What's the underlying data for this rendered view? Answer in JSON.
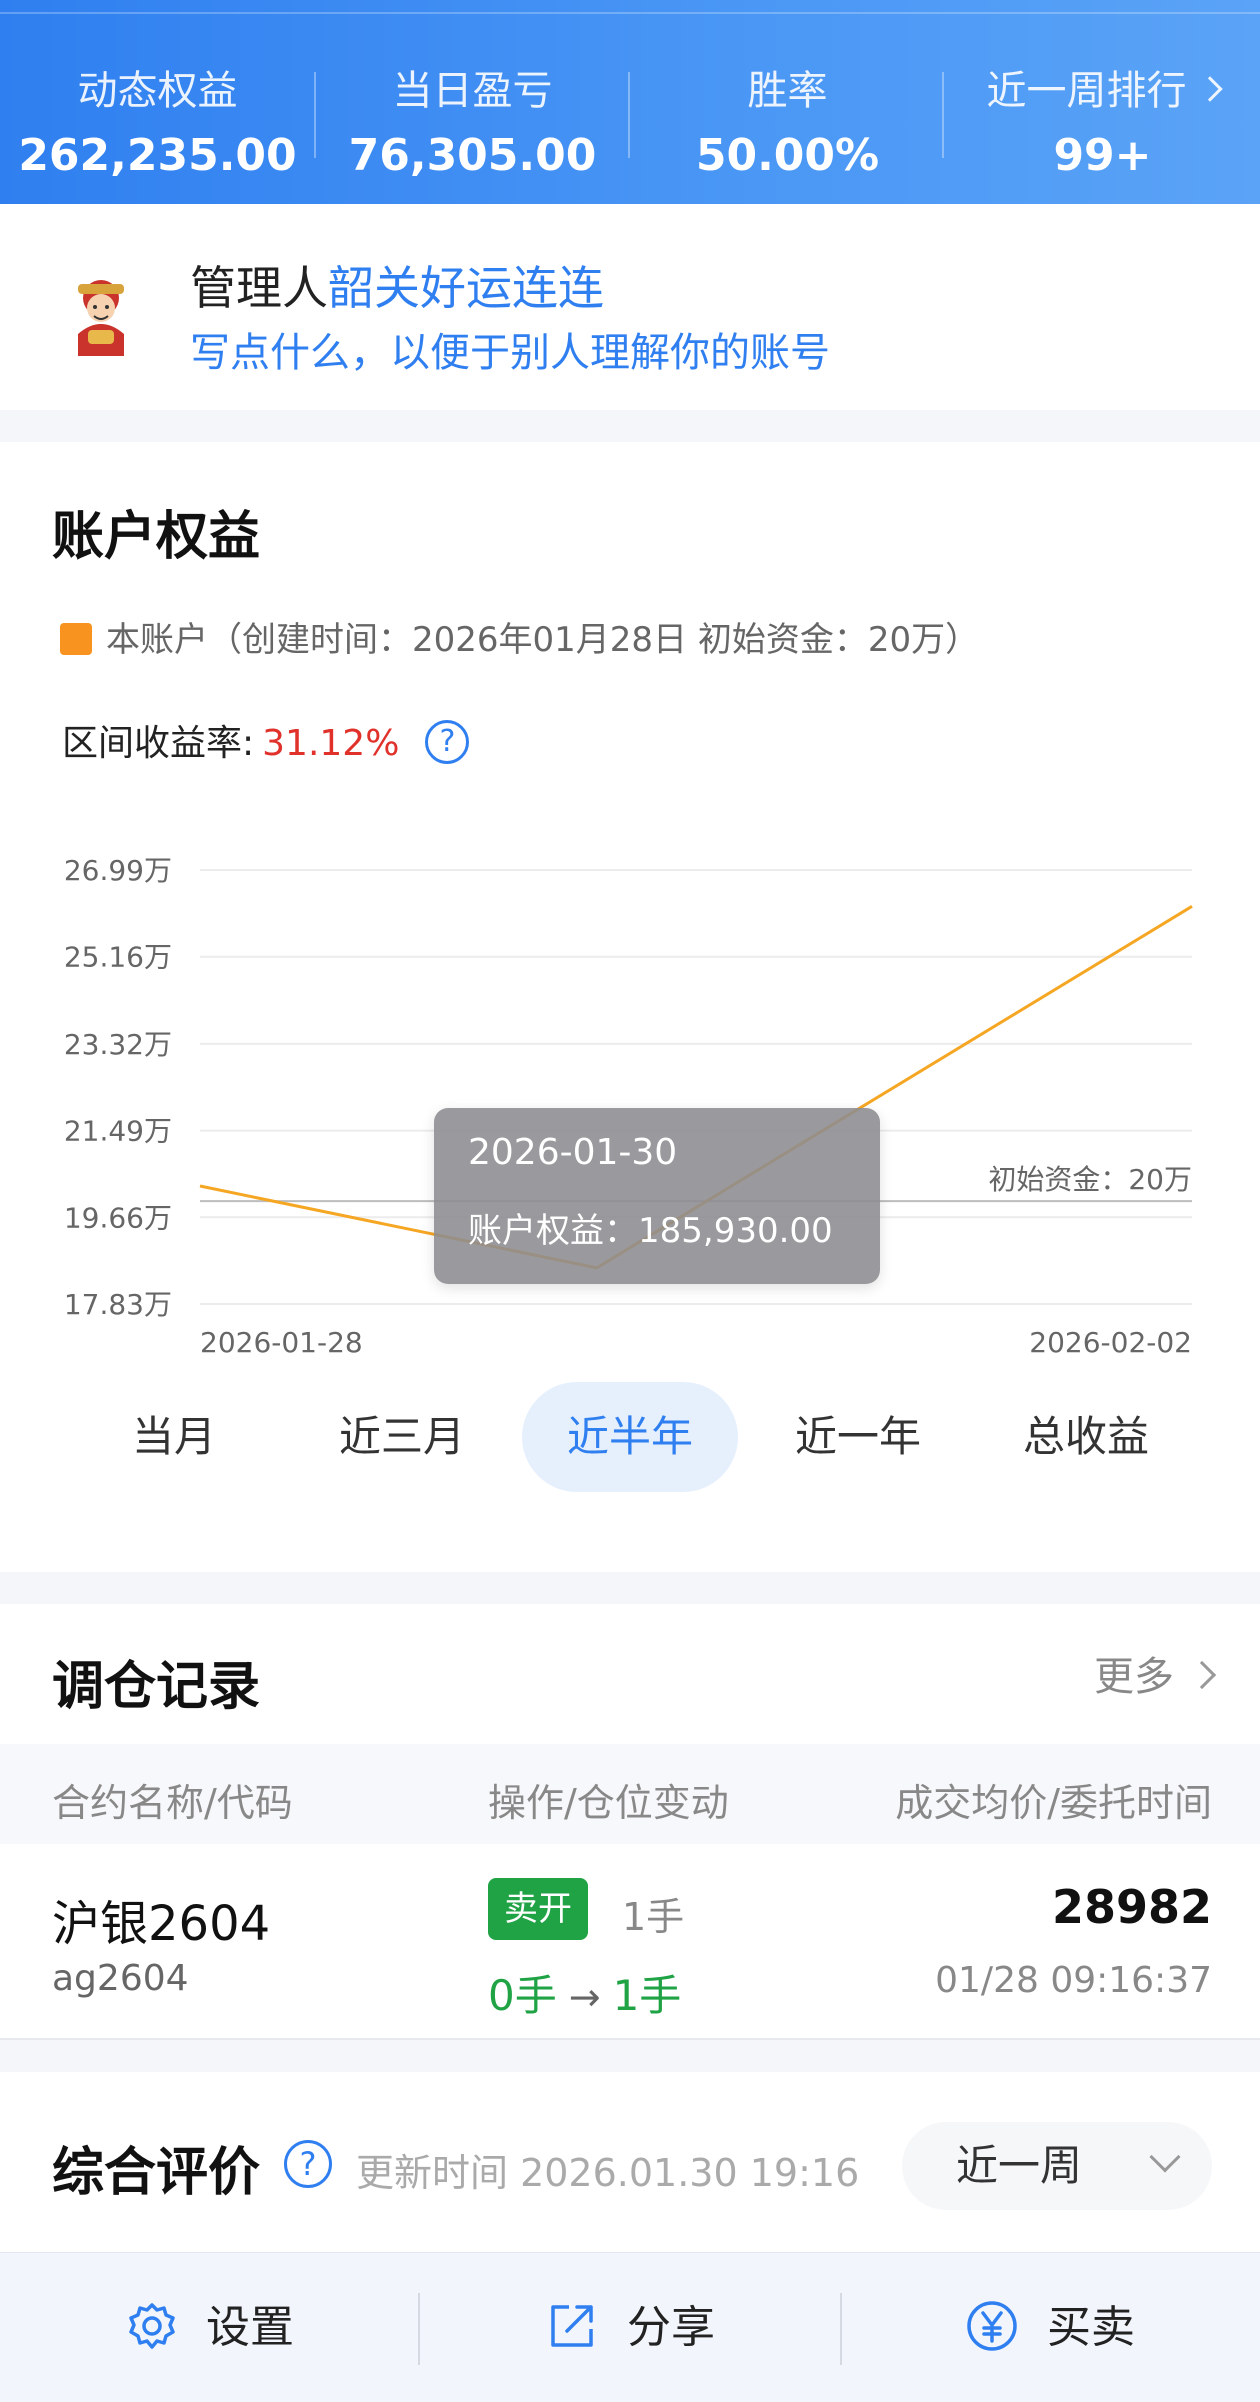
{
  "header": {
    "stats": [
      {
        "label": "动态权益",
        "value": "262,235.00"
      },
      {
        "label": "当日盈亏",
        "value": "76,305.00"
      },
      {
        "label": "胜率",
        "value": "50.00%"
      },
      {
        "label": "近一周排行",
        "value": "99+"
      }
    ]
  },
  "manager": {
    "prefix": "管理人",
    "name": "韶关好运连连",
    "description": "写点什么，以便于别人理解你的账号"
  },
  "equity": {
    "title": "账户权益",
    "legend": "本账户（创建时间：2026年01月28日 初始资金：20万）",
    "yield_label": "区间收益率:",
    "yield_value": "31.12%",
    "help_glyph": "?",
    "tooltip": {
      "date": "2026-01-30",
      "label": "账户权益：",
      "value": "185,930.00"
    },
    "baseline_label": "初始资金：20万",
    "tabs": [
      "当月",
      "近三月",
      "近半年",
      "近一年",
      "总收益"
    ],
    "active_tab": 2
  },
  "chart_data": {
    "type": "line",
    "title": "账户权益",
    "series": [
      {
        "name": "本账户",
        "color": "#f5a623",
        "values": [
          203200,
          185930,
          262235
        ]
      }
    ],
    "x": [
      "2026-01-28",
      "2026-01-30",
      "2026-02-02"
    ],
    "x_tick_labels": [
      "2026-01-28",
      "2026-02-02"
    ],
    "y_tick_labels": [
      "26.99万",
      "25.16万",
      "23.32万",
      "21.49万",
      "19.66万",
      "17.83万"
    ],
    "y_ticks": [
      269900,
      251600,
      233200,
      214900,
      196600,
      178300
    ],
    "ylim": [
      178300,
      269900
    ],
    "baseline": 200000,
    "grid": true
  },
  "records": {
    "title": "调仓记录",
    "more_label": "更多",
    "columns": [
      "合约名称/代码",
      "操作/仓位变动",
      "成交均价/委托时间"
    ],
    "rows": [
      {
        "name": "沪银2604",
        "code": "ag2604",
        "action": "卖开",
        "lots": "1手",
        "from": "0手",
        "arrow": "→",
        "to": "1手",
        "price": "28982",
        "time": "01/28 09:16:37"
      }
    ]
  },
  "rating": {
    "title": "综合评价",
    "updated": "更新时间 2026.01.30 19:16",
    "period": "近一周"
  },
  "bottom_bar": {
    "items": [
      {
        "label": "设置",
        "icon": "gear-icon"
      },
      {
        "label": "分享",
        "icon": "share-icon"
      },
      {
        "label": "买卖",
        "icon": "yen-icon"
      }
    ]
  },
  "colors": {
    "primary": "#2f7ff0",
    "line": "#f5a623",
    "up": "#e0312b",
    "down": "#1fa345"
  }
}
